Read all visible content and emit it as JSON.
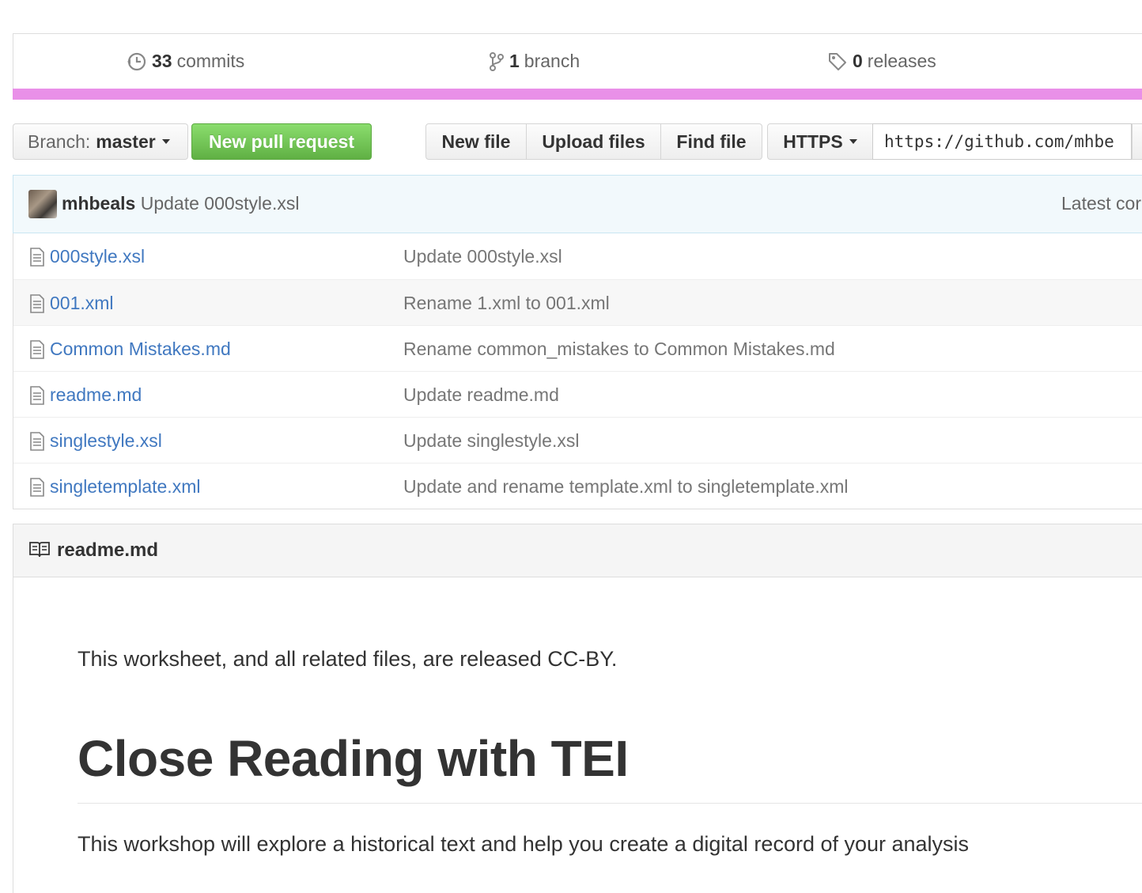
{
  "summary": {
    "commits_count": "33",
    "commits_label": "commits",
    "branch_count": "1",
    "branch_label": "branch",
    "releases_count": "0",
    "releases_label": "releases",
    "language_bar_color": "#e990e8"
  },
  "toolbar": {
    "branch_prefix": "Branch:",
    "branch_name": "master",
    "new_pull_request": "New pull request",
    "new_file": "New file",
    "upload_files": "Upload files",
    "find_file": "Find file",
    "protocol": "HTTPS",
    "clone_url": "https://github.com/mhbe"
  },
  "commit_tease": {
    "author": "mhbeals",
    "message": "Update 000style.xsl",
    "latest": "Latest cor"
  },
  "files": [
    {
      "name": "000style.xsl",
      "message": "Update 000style.xsl"
    },
    {
      "name": "001.xml",
      "message": "Rename 1.xml to 001.xml"
    },
    {
      "name": "Common Mistakes.md",
      "message": "Rename common_mistakes to Common Mistakes.md"
    },
    {
      "name": "readme.md",
      "message": "Update readme.md"
    },
    {
      "name": "singlestyle.xsl",
      "message": "Update singlestyle.xsl"
    },
    {
      "name": "singletemplate.xml",
      "message": "Update and rename template.xml to singletemplate.xml"
    }
  ],
  "readme": {
    "title": "readme.md",
    "license_text": "This worksheet, and all related files, are released CC-BY.",
    "heading": "Close Reading with TEI",
    "intro": "This workshop will explore a historical text and help you create a digital record of your analysis"
  }
}
